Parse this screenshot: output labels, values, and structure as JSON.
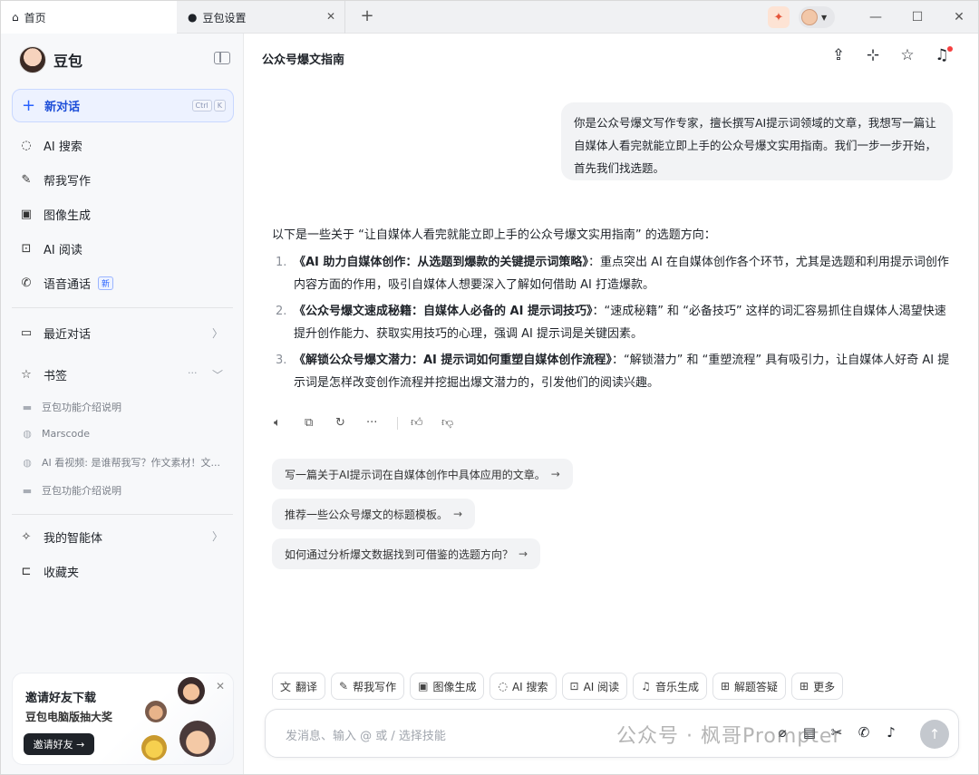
{
  "titlebar": {
    "tabs": [
      {
        "label": "首页",
        "icon": "home-icon"
      },
      {
        "label": "豆包设置",
        "icon": "doubao-avatar-icon"
      }
    ],
    "new_tab": "+",
    "window_controls": [
      "—",
      "☐",
      "✕"
    ]
  },
  "sidebar": {
    "brand": "豆包",
    "new_chat": {
      "label": "新对话",
      "shortcut": [
        "Ctrl",
        "K"
      ]
    },
    "nav": [
      {
        "label": "AI 搜索",
        "icon": "ai-search-icon"
      },
      {
        "label": "帮我写作",
        "icon": "pen-icon"
      },
      {
        "label": "图像生成",
        "icon": "image-icon"
      },
      {
        "label": "AI 阅读",
        "icon": "reading-icon"
      },
      {
        "label": "语音通话",
        "icon": "phone-icon",
        "badge": "新"
      }
    ],
    "recent": "最近对话",
    "bookmarks": {
      "label": "书签",
      "more": "···",
      "items": [
        "豆包功能介绍说明",
        "Marscode",
        "AI 看视频: 是谁帮我写？作文素材！文...",
        "豆包功能介绍说明"
      ]
    },
    "agents": "我的智能体",
    "favorites": "收藏夹",
    "promo": {
      "line1": "邀请好友下载",
      "line2": "豆包电脑版抽大奖",
      "button": "邀请好友 →"
    }
  },
  "main": {
    "title": "公众号爆文指南",
    "user_message": "你是公众号爆文写作专家，擅长撰写AI提示词领域的文章，我想写一篇让自媒体人看完就能立即上手的公众号爆文实用指南。我们一步一步开始，首先我们找选题。",
    "answer": {
      "intro": "以下是一些关于 “让自媒体人看完就能立即上手的公众号爆文实用指南” 的选题方向：",
      "items": [
        {
          "num": "1.",
          "title": "《AI 助力自媒体创作：从选题到爆款的关键提示词策略》",
          "body": "：重点突出 AI 在自媒体创作各个环节，尤其是选题和利用提示词创作内容方面的作用，吸引自媒体人想要深入了解如何借助 AI 打造爆款。"
        },
        {
          "num": "2.",
          "title": "《公众号爆文速成秘籍：自媒体人必备的 AI 提示词技巧》",
          "body": "：“速成秘籍” 和 “必备技巧” 这样的词汇容易抓住自媒体人渴望快速提升创作能力、获取实用技巧的心理，强调 AI 提示词是关键因素。"
        },
        {
          "num": "3.",
          "title": "《解锁公众号爆文潜力：AI 提示词如何重塑自媒体创作流程》",
          "body": "：“解锁潜力” 和 “重塑流程” 具有吸引力，让自媒体人好奇 AI 提示词是怎样改变创作流程并挖掘出爆文潜力的，引发他们的阅读兴趣。"
        }
      ]
    },
    "suggestions": [
      "写一篇关于AI提示词在自媒体创作中具体应用的文章。",
      "推荐一些公众号爆文的标题模板。",
      "如何通过分析爆文数据找到可借鉴的选题方向？"
    ],
    "skills": [
      {
        "label": "翻译",
        "icon": "translate-icon"
      },
      {
        "label": "帮我写作",
        "icon": "pen-icon"
      },
      {
        "label": "图像生成",
        "icon": "image-icon"
      },
      {
        "label": "AI 搜索",
        "icon": "ai-search-icon"
      },
      {
        "label": "AI 阅读",
        "icon": "reading-icon"
      },
      {
        "label": "音乐生成",
        "icon": "music-icon"
      },
      {
        "label": "解题答疑",
        "icon": "solve-icon"
      },
      {
        "label": "更多",
        "icon": "grid-icon"
      }
    ],
    "input": {
      "placeholder": "发消息、输入 @ 或 / 选择技能"
    },
    "watermark": "公众号 · 枫哥Prompter"
  },
  "colors": {
    "accent": "#2962ff",
    "sidebar_bg": "#f7f8fa",
    "bubble_bg": "#f2f3f5"
  }
}
